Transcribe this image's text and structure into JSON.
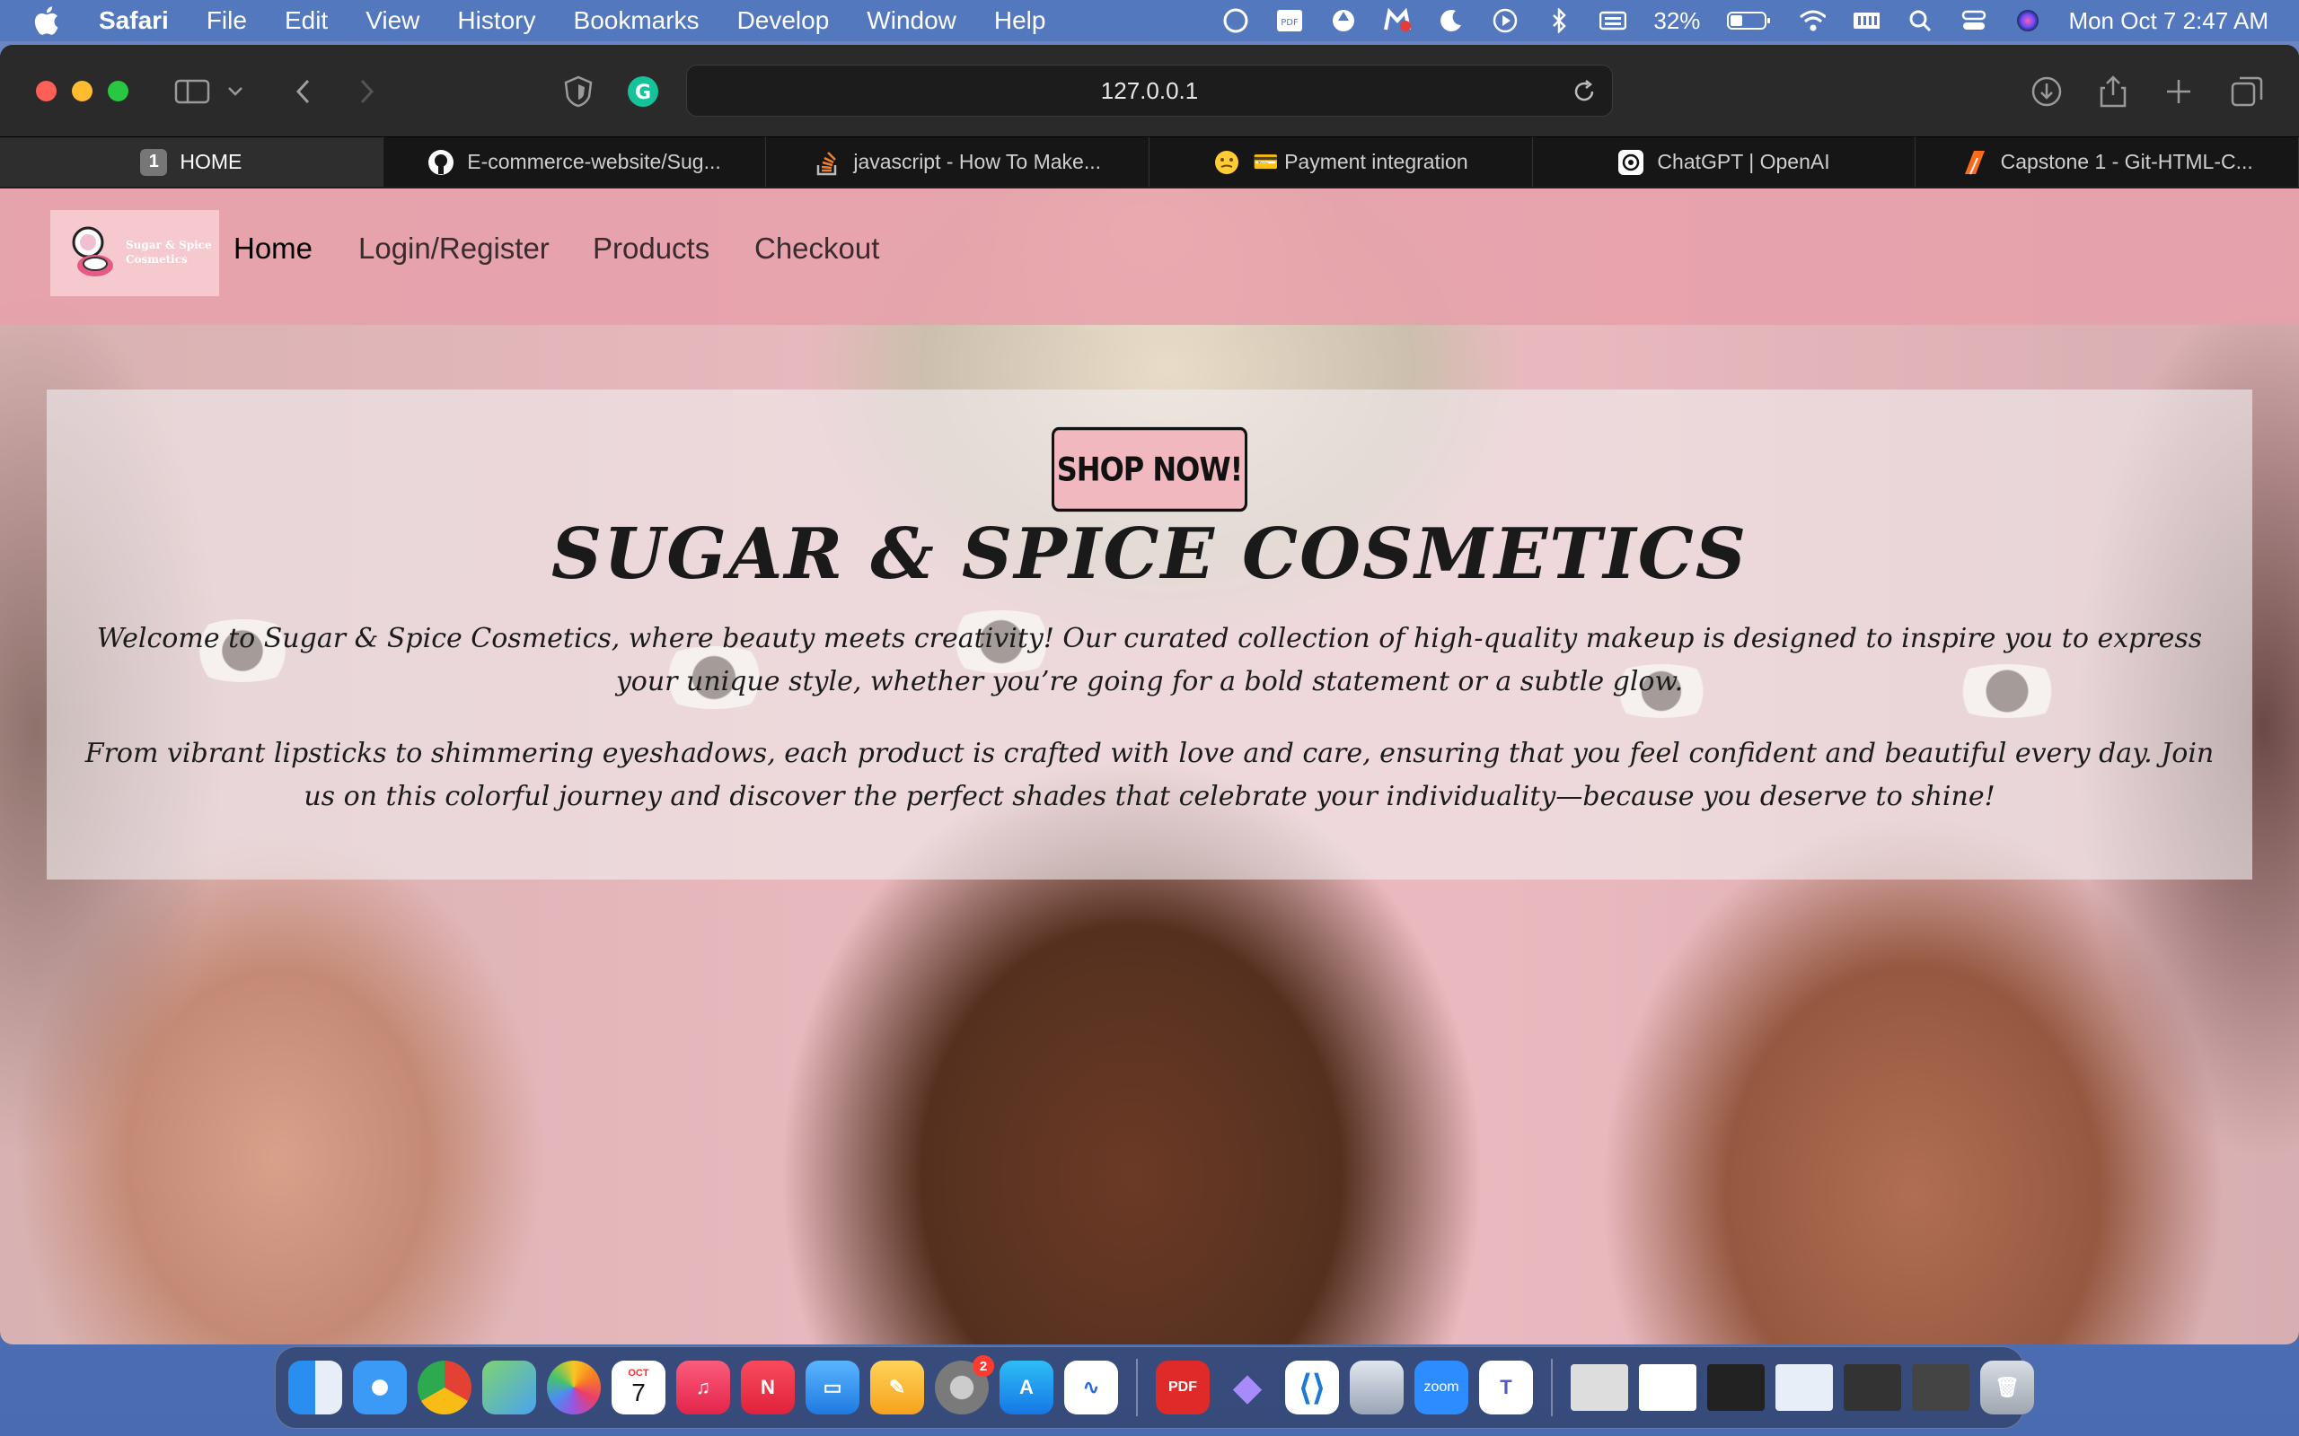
{
  "menubar": {
    "app_name": "Safari",
    "items": [
      "File",
      "Edit",
      "View",
      "History",
      "Bookmarks",
      "Develop",
      "Window",
      "Help"
    ],
    "battery": "32%",
    "clock": "Mon Oct 7  2:47 AM"
  },
  "browser": {
    "url": "127.0.0.1",
    "tabs": [
      {
        "label": "HOME",
        "number": "1",
        "active": true
      },
      {
        "label": "E-commerce-website/Sug...",
        "icon": "github-icon"
      },
      {
        "label": "javascript - How To Make...",
        "icon": "stackoverflow-icon"
      },
      {
        "label": "💳 Payment integration",
        "icon": "emoji-icon"
      },
      {
        "label": "ChatGPT | OpenAI",
        "icon": "openai-icon"
      },
      {
        "label": "Capstone 1 - Git-HTML-C...",
        "icon": "capstone-icon"
      }
    ]
  },
  "site": {
    "logo_text": "Sugar & Spice Cosmetics",
    "nav": [
      "Home",
      "Login/Register",
      "Products",
      "Checkout"
    ],
    "cta_label": "SHOP NOW!",
    "title": "SUGAR & SPICE COSMETICS",
    "paragraph_1": "Welcome to Sugar & Spice Cosmetics, where beauty meets creativity! Our curated collection of high-quality makeup is designed to inspire you to express your unique style, whether you’re going for a bold statement or a subtle glow.",
    "paragraph_2": "From vibrant lipsticks to shimmering eyeshadows, each product is crafted with love and care, ensuring that you feel confident and beautiful every day. Join us on this colorful journey and discover the perfect shades that celebrate your individuality—because you deserve to shine!"
  },
  "dock": {
    "calendar_month": "OCT",
    "calendar_day": "7",
    "settings_badge": "2",
    "pdf_label": "PDF",
    "zoom_label": "zoom"
  }
}
